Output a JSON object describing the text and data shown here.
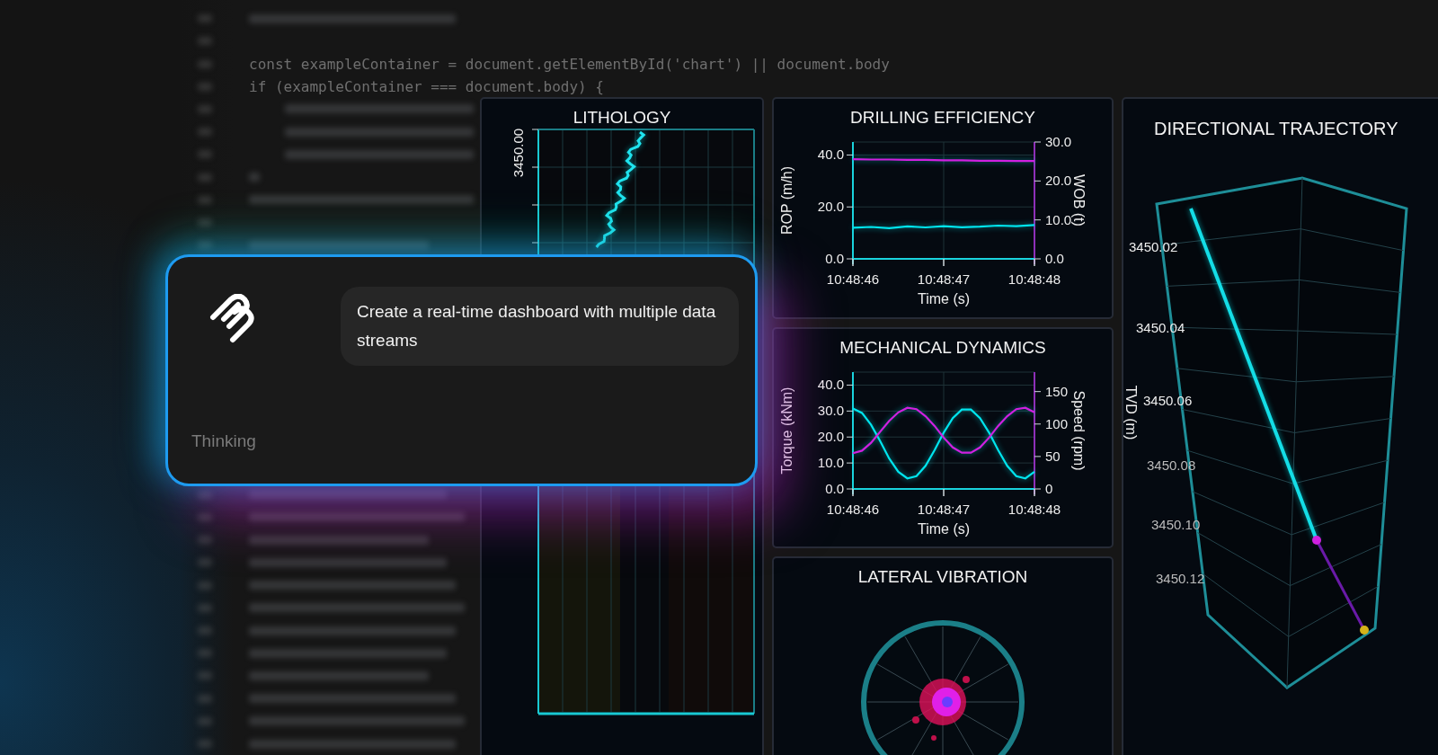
{
  "code_editor": {
    "lines": [
      {
        "text": "const exampleContainer = document.getElementById('chart') || document.body"
      },
      {
        "text": "if (exampleContainer === document.body) {"
      }
    ]
  },
  "dashboard": {
    "panels": [
      {
        "kind": "lithology",
        "title": "LITHOLOGY",
        "axis_label": "3450.00"
      },
      {
        "kind": "line_chart",
        "title": "DRILLING EFFICIENCY",
        "chart_data": {
          "type": "line",
          "xlabel": "Time (s)",
          "ylabel": "ROP (m/h)",
          "y2label": "WOB (t)",
          "categories": [
            "10:48:46",
            null,
            null,
            null,
            null,
            "10:48:47",
            null,
            null,
            null,
            null,
            "10:48:48"
          ],
          "ylim": [
            0,
            45
          ],
          "y2lim": [
            0,
            30
          ],
          "grid": true,
          "yticks": [
            {
              "value": 0,
              "label": "0.0"
            },
            {
              "value": 20,
              "label": "20.0"
            },
            {
              "value": 40,
              "label": "40.0"
            }
          ],
          "y2ticks": [
            {
              "value": 0,
              "label": "0.0"
            },
            {
              "value": 10,
              "label": "10.0"
            },
            {
              "value": 20,
              "label": "20.0"
            },
            {
              "value": 30,
              "label": "30.0"
            }
          ],
          "series": [
            {
              "color": "#00e5ee",
              "values": [
                12.0,
                12.3,
                11.8,
                12.5,
                12.1,
                12.6,
                12.2,
                12.4,
                12.8,
                12.6,
                13.0
              ]
            },
            {
              "color": "#d020e0",
              "axis": "y2",
              "values": [
                25.6,
                25.5,
                25.5,
                25.4,
                25.4,
                25.3,
                25.3,
                25.2,
                25.2,
                25.1,
                25.1
              ]
            }
          ]
        }
      },
      {
        "kind": "trajectory",
        "title": "DIRECTIONAL TRAJECTORY",
        "tick_labels": [
          "3450.02",
          "3450.04",
          "3450.06",
          "3450.08",
          "3450.10",
          "3450.12"
        ],
        "axis_label": "TVD (m)"
      },
      {
        "kind": "line_chart",
        "title": "MECHANICAL DYNAMICS",
        "chart_data": {
          "type": "line",
          "xlabel": "Time (s)",
          "ylabel": "Torque (kNm)",
          "y2label": "Speed (rpm)",
          "categories": [
            "10:48:46",
            null,
            null,
            null,
            null,
            null,
            null,
            null,
            null,
            null,
            "10:48:47",
            null,
            null,
            null,
            null,
            null,
            null,
            null,
            null,
            null,
            "10:48:48"
          ],
          "ylim": [
            0,
            45
          ],
          "y2lim": [
            0,
            180
          ],
          "grid": true,
          "yticks": [
            {
              "value": 0,
              "label": "0.0"
            },
            {
              "value": 10,
              "label": "10.0"
            },
            {
              "value": 20,
              "label": "20.0"
            },
            {
              "value": 30,
              "label": "30.0"
            },
            {
              "value": 40,
              "label": "40.0"
            }
          ],
          "y2ticks": [
            0,
            50,
            100,
            150
          ],
          "series": [
            {
              "color": "#00e5ee",
              "values": [
                31.0,
                29.3,
                24.7,
                18.4,
                11.7,
                6.6,
                4.1,
                4.9,
                8.9,
                15.0,
                21.7,
                27.3,
                30.6,
                30.6,
                27.3,
                21.7,
                15.0,
                8.9,
                4.9,
                4.1,
                6.6
              ]
            },
            {
              "color": "#d020e0",
              "axis": "y2",
              "values": [
                55,
                59,
                71,
                88,
                105,
                118,
                125,
                123,
                112,
                97,
                79,
                64,
                56,
                56,
                64,
                79,
                97,
                112,
                123,
                125,
                118
              ]
            }
          ]
        }
      },
      {
        "kind": "polar",
        "title": "LATERAL VIBRATION"
      }
    ]
  },
  "prompt_card": {
    "message": "Create a real-time dashboard with multiple data streams",
    "status": "Thinking"
  }
}
